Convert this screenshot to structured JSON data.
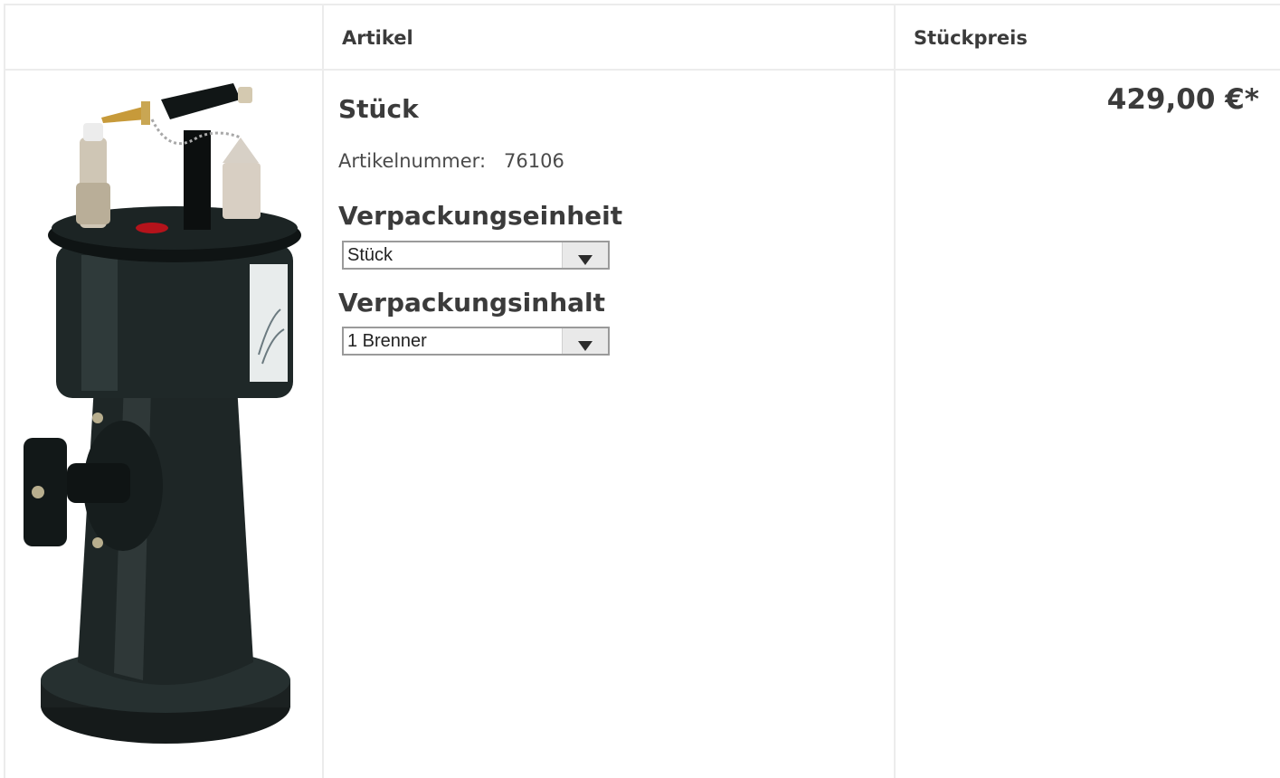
{
  "table": {
    "headers": {
      "image": "",
      "article": "Artikel",
      "unit_price": "Stückpreis"
    }
  },
  "product": {
    "image_icon": "product-photo-burner",
    "title": "Stück",
    "article_number_label": "Artikelnummer:",
    "article_number": "76106",
    "packaging_unit_label": "Verpackungseinheit",
    "packaging_unit_value": "Stück",
    "packaging_content_label": "Verpackungsinhalt",
    "packaging_content_value": "1 Brenner",
    "price": "429,00 €*"
  },
  "colors": {
    "border": "#ececec",
    "text": "#3b3b3b"
  }
}
